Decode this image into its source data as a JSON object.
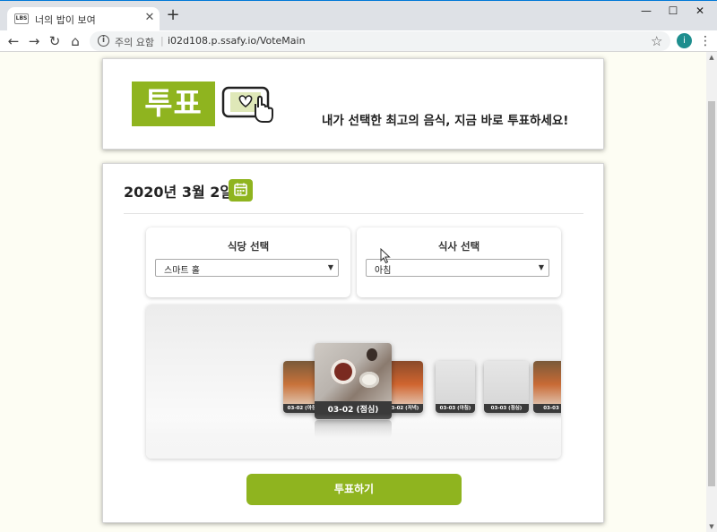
{
  "browser": {
    "tab_title": "너의 밥이 보여",
    "favicon_text": "LBS",
    "secure_label": "주의 요함",
    "url": "i02d108.p.ssafy.io/VoteMain",
    "profile_initial": "i"
  },
  "header": {
    "logo_text": "투표",
    "slogan": "내가 선택한 최고의 음식, 지금 바로 투표하세요!"
  },
  "vote": {
    "date": "2020년 3월 2일",
    "restaurant": {
      "title": "식당 선택",
      "selected": "스마트 홀"
    },
    "meal": {
      "title": "식사 선택",
      "selected": "아침"
    },
    "carousel": {
      "slides": [
        {
          "caption": "03-02 (아침)"
        },
        {
          "caption": "03-02 (점심)"
        },
        {
          "caption": "03-02 (저녁)"
        },
        {
          "caption": "03-03 (아침)"
        },
        {
          "caption": "03-03 (점심)"
        },
        {
          "caption": "03-03"
        }
      ]
    },
    "submit_label": "투표하기"
  },
  "colors": {
    "accent": "#8fb41f",
    "page_bg": "#fdfdf3"
  }
}
